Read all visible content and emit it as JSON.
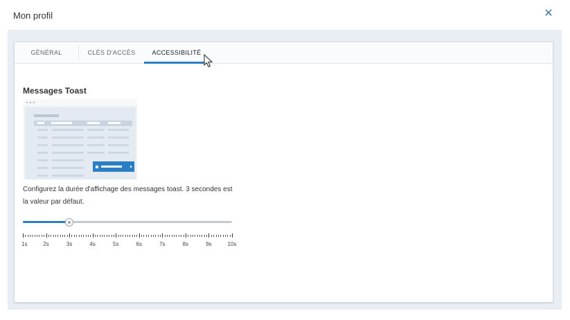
{
  "dialog": {
    "title": "Mon profil"
  },
  "tabs": [
    {
      "label": "GÉNÉRAL",
      "active": false
    },
    {
      "label": "CLÉS D'ACCÈS",
      "active": false
    },
    {
      "label": "ACCESSIBILITÉ",
      "active": true
    }
  ],
  "toast_section": {
    "title": "Messages Toast",
    "description": "Configurez la durée d'affichage des messages toast. 3 secondes est la valeur par défaut."
  },
  "slider": {
    "min": 1,
    "max": 10,
    "value": 3,
    "unit": "s",
    "labels": [
      "1s",
      "2s",
      "3s",
      "4s",
      "5s",
      "6s",
      "7s",
      "8s",
      "9s",
      "10s"
    ]
  },
  "colors": {
    "accent": "#2a7fc4",
    "backdrop": "#e8eef4",
    "track": "#c5c9cc"
  },
  "icons": {
    "close": "close-icon",
    "cursor": "mouse-pointer-icon"
  }
}
